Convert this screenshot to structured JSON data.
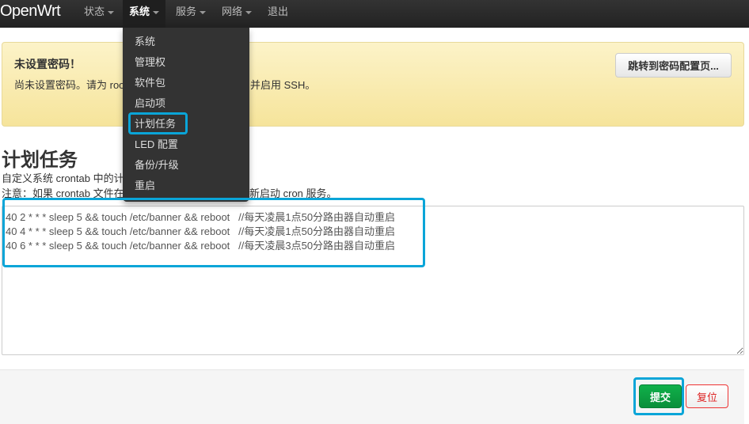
{
  "nav": {
    "brand": "OpenWrt",
    "items": [
      {
        "label": "状态"
      },
      {
        "label": "系统",
        "active": true
      },
      {
        "label": "服务"
      },
      {
        "label": "网络"
      },
      {
        "label": "退出"
      }
    ]
  },
  "dropdown": {
    "items": [
      "系统",
      "管理权",
      "软件包",
      "启动项",
      "计划任务",
      "LED 配置",
      "备份/升级",
      "重启"
    ],
    "highlighted": "计划任务"
  },
  "alert": {
    "title": "未设置密码！",
    "text_left": "尚未设置密码。请为 roo",
    "text_right": "并启用 SSH。",
    "button": "跳转到密码配置页..."
  },
  "page": {
    "title": "计划任务",
    "desc1": "自定义系统 crontab 中的计",
    "desc2_left": "注意：如果 crontab 文件在",
    "desc2_right": "新启动 cron 服务。"
  },
  "crontab": "40 2 * * * sleep 5 && touch /etc/banner && reboot   //每天凌晨1点50分路由器自动重启\n40 4 * * * sleep 5 && touch /etc/banner && reboot   //每天凌晨1点50分路由器自动重启\n40 6 * * * sleep 5 && touch /etc/banner && reboot   //每天凌晨3点50分路由器自动重启",
  "footer": {
    "submit": "提交",
    "reset": "复位"
  },
  "colors": {
    "highlight": "#0aa5d8",
    "submit": "#0a9e42",
    "reset": "#dd2222"
  }
}
